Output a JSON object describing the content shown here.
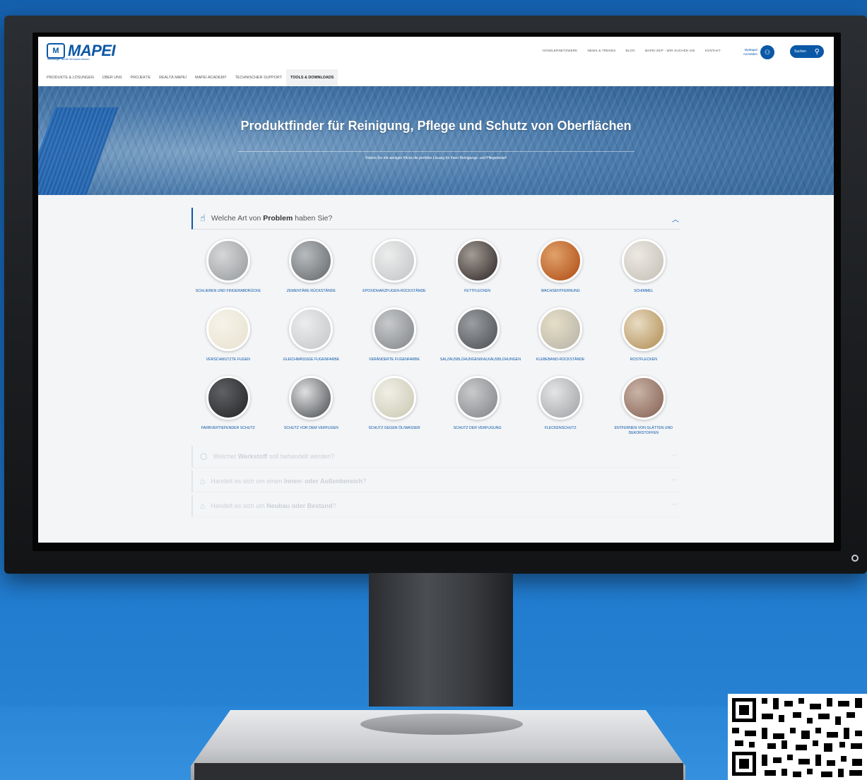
{
  "header": {
    "logo_text": "MAPEI",
    "logo_tagline": "Technologie, auf die Sie bauen können.",
    "top_links": [
      "HÄNDLERNETZWERK",
      "NEWS & TRENDS",
      "BLOG",
      "MAPEI EEP - WIR SUCHEN SIE",
      "KONTAKT"
    ],
    "mymapei_label": "MyMapei Anmelden",
    "search_label": "Suchen"
  },
  "nav": {
    "items": [
      {
        "label": "PRODUKTE & LÖSUNGEN"
      },
      {
        "label": "ÜBER UNS"
      },
      {
        "label": "PROJEKTE"
      },
      {
        "label": "REALTÀ MAPEI"
      },
      {
        "label": "MAPEI ACADEMY"
      },
      {
        "label": "TECHNISCHER SUPPORT"
      },
      {
        "label": "TOOLS & DOWNLOADS",
        "active": true
      }
    ]
  },
  "hero": {
    "title": "Produktfinder für Reinigung, Pflege und Schutz von Oberflächen",
    "subtitle": "Finden Sie mit wenigen Klicks die perfekte Lösung für Ihren Reinigungs- und Pflegebedarf"
  },
  "problem_section": {
    "prefix": "Welche Art von ",
    "bold": "Problem",
    "suffix": " haben Sie?"
  },
  "tiles": [
    [
      {
        "label": "SCHLIEREN UND FINGERABDRÜCKE",
        "color1": "#9ea1a4",
        "color2": "#d6d7d8"
      },
      {
        "label": "ZEMENTÄRE RÜCKSTÄNDE",
        "color1": "#6f7275",
        "color2": "#b9bcbf"
      },
      {
        "label": "EPOXIDHARZFUGEN-RÜCKSTÄNDE",
        "color1": "#c7c9ca",
        "color2": "#eceded"
      },
      {
        "label": "FETTFLECKEN",
        "color1": "#3b3534",
        "color2": "#a49b94"
      },
      {
        "label": "WACHSENTFERNUNG",
        "color1": "#b5561f",
        "color2": "#e0a26a"
      },
      {
        "label": "SCHIMMEL",
        "color1": "#c9c4bb",
        "color2": "#ece9e3"
      }
    ],
    [
      {
        "label": "VERSCHMUTZTE FUGEN",
        "color1": "#e9e4d2",
        "color2": "#f6f3ea"
      },
      {
        "label": "GLEICHMÄSSIGE FUGENFARBE",
        "color1": "#c8cacc",
        "color2": "#eceded"
      },
      {
        "label": "VERÄNDERTE FUGENFARBE",
        "color1": "#8b8e91",
        "color2": "#c7c9cb"
      },
      {
        "label": "SALZAUSBLÜHUNGEN/KALKAUSBLÜHUNGEN",
        "color1": "#55595d",
        "color2": "#9b9fa2"
      },
      {
        "label": "KLEBEBAND-RÜCKSTÄNDE",
        "color1": "#bcb7aa",
        "color2": "#e6dfc8"
      },
      {
        "label": "ROSTFLECKEN",
        "color1": "#b89660",
        "color2": "#e8dcc4"
      }
    ],
    [
      {
        "label": "FARBVERTIEFENDER SCHUTZ",
        "color1": "#2b2c2e",
        "color2": "#5f6164"
      },
      {
        "label": "SCHUTZ VOR DEM VERFUGEN",
        "color1": "#5c5f63",
        "color2": "#dfe0e1"
      },
      {
        "label": "SCHUTZ GEGEN ÖL/WASSER",
        "color1": "#cfcdb8",
        "color2": "#f0efe6"
      },
      {
        "label": "SCHUTZ DER VERFUGUNG",
        "color1": "#8a8c8f",
        "color2": "#c9cacc"
      },
      {
        "label": "FLECKENSCHUTZ",
        "color1": "#a8aaad",
        "color2": "#e4e5e6"
      },
      {
        "label": "ENTFERNEN VON GLÄTTEN UND DEKORSTOFFEN",
        "color1": "#8d6a5c",
        "color2": "#c9b4a6"
      }
    ]
  ],
  "faded_sections": [
    {
      "icon": "cube-icon",
      "prefix": "Welcher ",
      "bold": "Werkstoff",
      "suffix": " soll behandelt werden?"
    },
    {
      "icon": "building-icon",
      "prefix": "Handelt es sich um einen ",
      "bold": "Innen- oder Außenbereich",
      "suffix": "?"
    },
    {
      "icon": "house-icon",
      "prefix": "Handelt es sich um ",
      "bold": "Neubau oder Bestand",
      "suffix": "?"
    }
  ],
  "colors": {
    "brand": "#0b58a7",
    "background": "#1a6bbd"
  }
}
